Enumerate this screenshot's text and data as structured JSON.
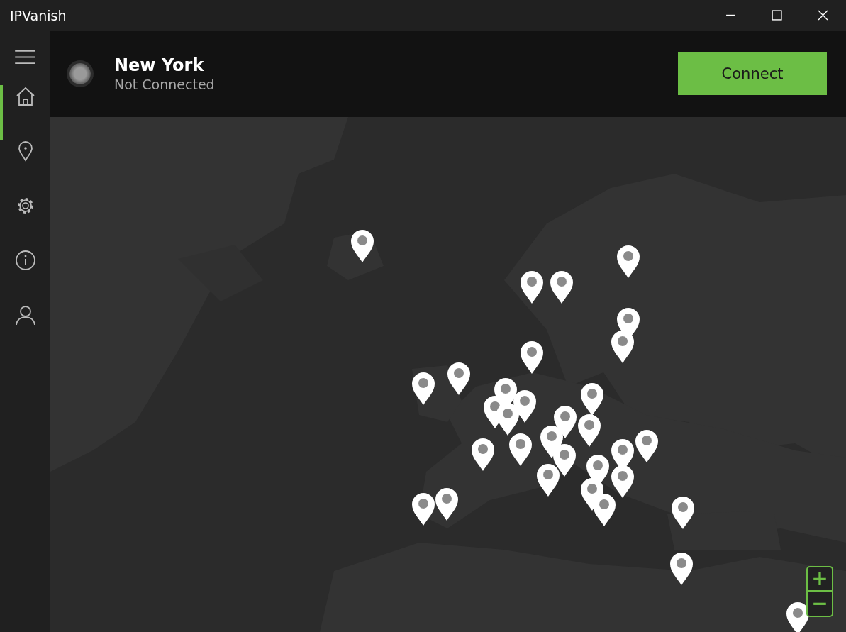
{
  "window": {
    "title": "IPVanish"
  },
  "sidebar": {
    "items": [
      {
        "kind": "home",
        "selected": true
      },
      {
        "kind": "location",
        "selected": false
      },
      {
        "kind": "settings",
        "selected": false
      },
      {
        "kind": "info",
        "selected": false
      },
      {
        "kind": "account",
        "selected": false
      }
    ]
  },
  "header": {
    "location": "New York",
    "status": "Not Connected",
    "connected": false,
    "button": "Connect"
  },
  "map": {
    "kind": "picture",
    "zoom_in": "+",
    "zoom_out": "−"
  }
}
